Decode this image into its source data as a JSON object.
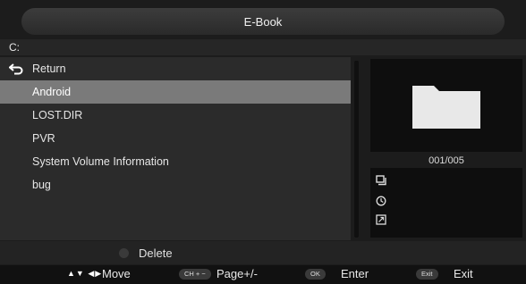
{
  "title": "E-Book",
  "path": "C:",
  "return_label": "Return",
  "files": [
    {
      "name": "Android",
      "selected": true
    },
    {
      "name": "LOST.DIR",
      "selected": false
    },
    {
      "name": "PVR",
      "selected": false
    },
    {
      "name": "System Volume Information",
      "selected": false
    },
    {
      "name": "bug",
      "selected": false
    }
  ],
  "counter": "001/005",
  "delete_label": "Delete",
  "help": {
    "move_keys": "▲▼ ◀▶",
    "move_label": "Move",
    "page_key": "CH + −",
    "page_label": "Page+/-",
    "enter_key": "OK",
    "enter_label": "Enter",
    "exit_key": "Exit",
    "exit_label": "Exit"
  },
  "colors": {
    "selected_row": "#7a7a7a",
    "folder": "#e8e8e8"
  }
}
